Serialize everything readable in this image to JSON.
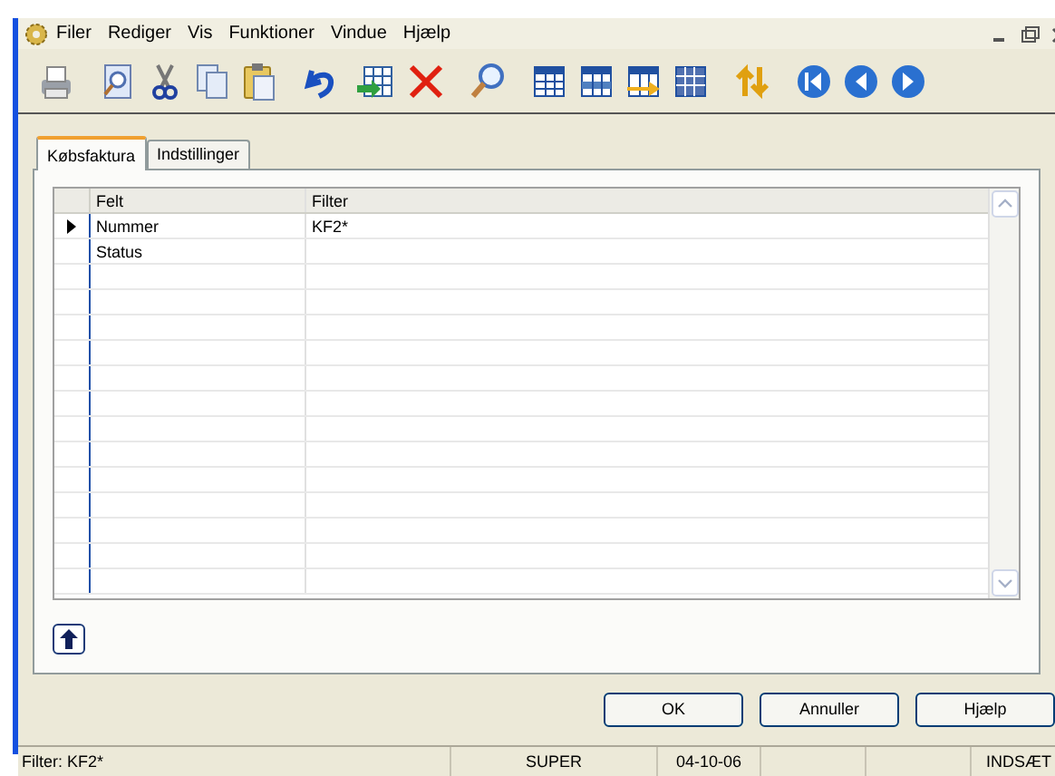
{
  "menu": [
    "Filer",
    "Rediger",
    "Vis",
    "Funktioner",
    "Vindue",
    "Hjælp"
  ],
  "tabs": [
    {
      "label": "Købsfaktura",
      "selected": true
    },
    {
      "label": "Indstillinger",
      "selected": false
    }
  ],
  "grid": {
    "columns": [
      "Felt",
      "Filter"
    ],
    "rows": [
      {
        "felt": "Nummer",
        "filter": "KF2*",
        "current": true
      },
      {
        "felt": "Status",
        "current": false
      }
    ]
  },
  "buttons": [
    "OK",
    "Annuller",
    "Hjælp"
  ],
  "status_bar": [
    "Filter: KF2*",
    "SUPER",
    "04-10-06",
    "INDSÆT"
  ]
}
